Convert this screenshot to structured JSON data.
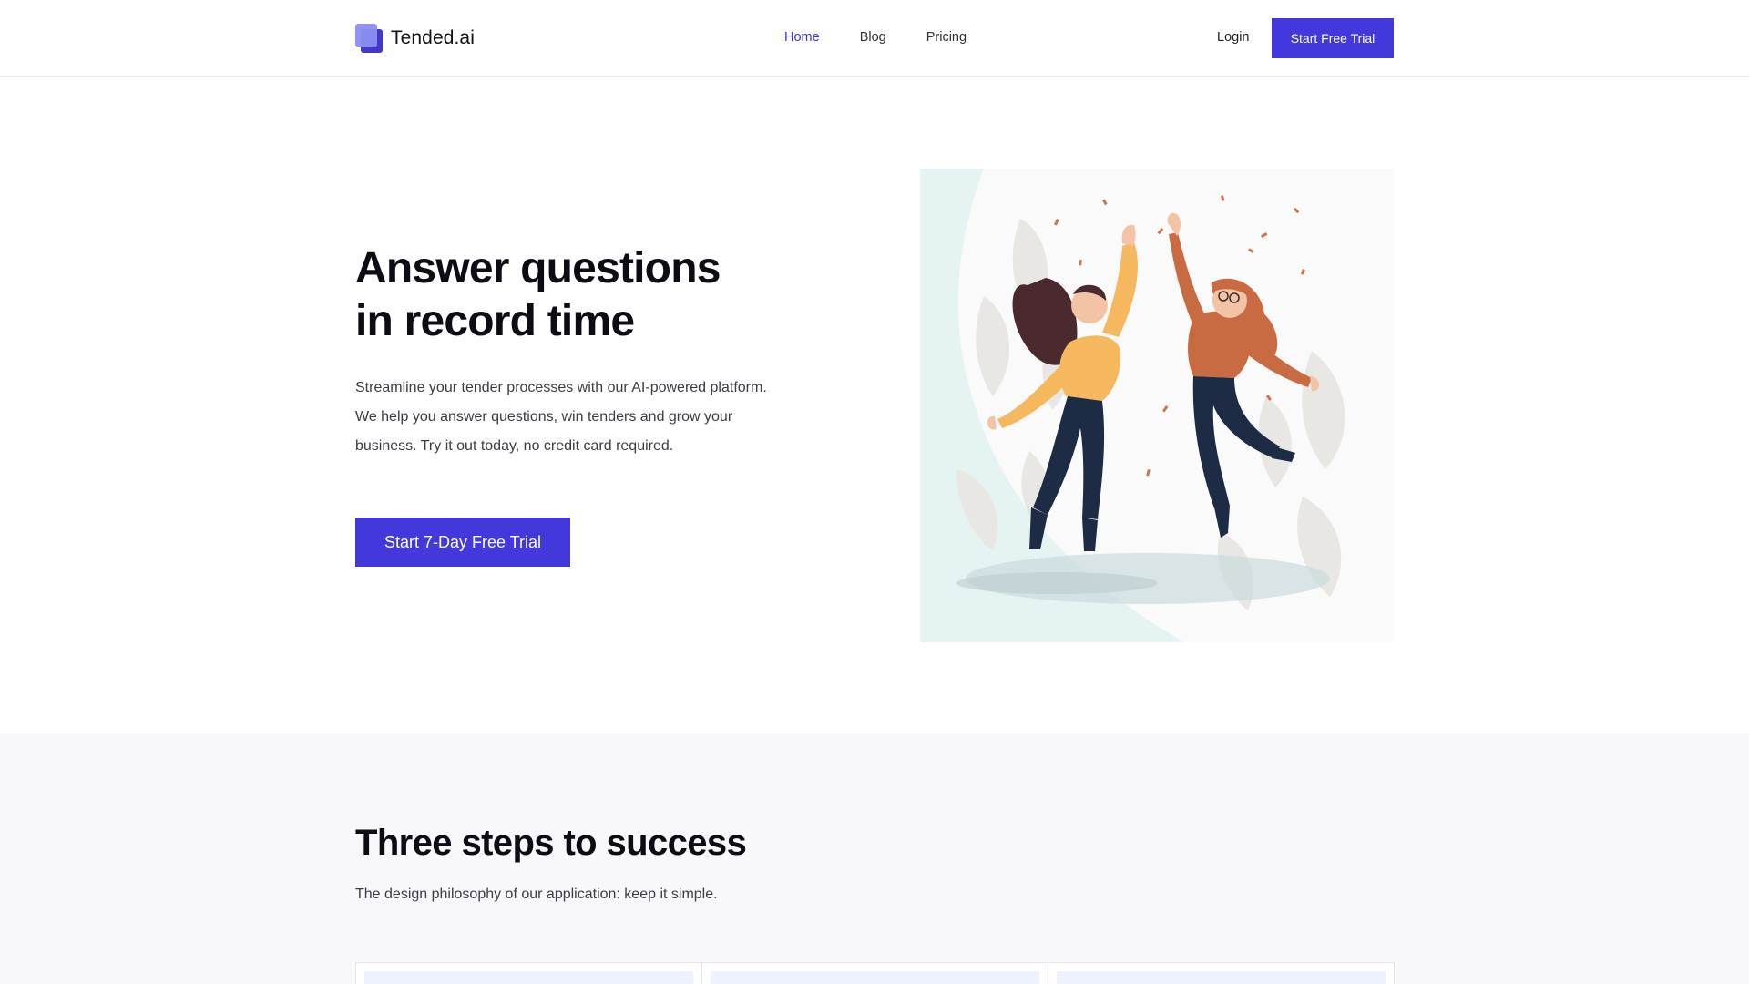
{
  "brand": {
    "name": "Tended.ai",
    "accent": "#4338dc"
  },
  "nav": {
    "home": "Home",
    "blog": "Blog",
    "pricing": "Pricing"
  },
  "header": {
    "login": "Login",
    "trial_button": "Start Free Trial"
  },
  "hero": {
    "title_line1": "Answer questions",
    "title_line2": "in record time",
    "description": "Streamline your tender processes with our AI-powered platform. We help you answer questions, win tenders and grow your business. Try it out today, no credit card required.",
    "cta": "Start 7-Day Free Trial",
    "illustration": "two-women-jumping-celebration-illustration"
  },
  "steps": {
    "title": "Three steps to success",
    "subtitle": "The design philosophy of our application: keep it simple."
  }
}
